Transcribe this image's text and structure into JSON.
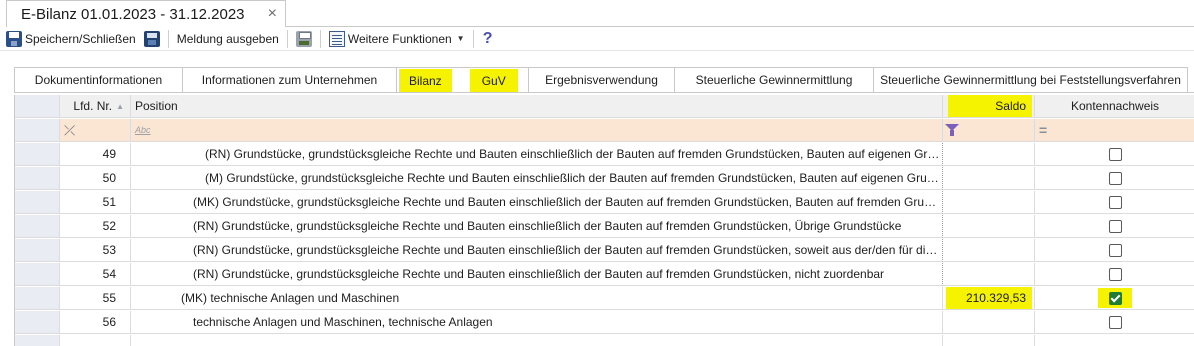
{
  "document_tab": {
    "title": "E-Bilanz 01.01.2023 - 31.12.2023",
    "close": "×"
  },
  "toolbar": {
    "save_close": "Speichern/Schließen",
    "report": "Meldung ausgeben",
    "more_functions": "Weitere Funktionen",
    "icons": [
      "save-close-icon",
      "disk-icon",
      "printer-icon",
      "functions-list-icon",
      "help-icon"
    ]
  },
  "tabs": [
    {
      "label": "Dokumentinformationen"
    },
    {
      "label": "Informationen zum Unternehmen"
    },
    {
      "label": "Bilanz",
      "active": true
    },
    {
      "label": "GuV"
    },
    {
      "label": "Ergebnisverwendung"
    },
    {
      "label": "Steuerliche Gewinnermittlung"
    },
    {
      "label": "Steuerliche Gewinnermittlung bei Feststellungsverfahren"
    }
  ],
  "grid": {
    "headers": {
      "nr": "Lfd. Nr.",
      "position": "Position",
      "saldo": "Saldo",
      "kontennachweis": "Kontennachweis"
    },
    "filter": {
      "position_placeholder": "Abc"
    },
    "rows": [
      {
        "nr": "49",
        "position": "(RN) Grundstücke, grundstücksgleiche Rechte und Bauten einschließlich der Bauten auf fremden Grundstücken, Bauten auf eigenen Grun…",
        "saldo": "",
        "checked": false
      },
      {
        "nr": "50",
        "position": "(M) Grundstücke, grundstücksgleiche Rechte und Bauten einschließlich der Bauten auf fremden Grundstücken, Bauten auf eigenen Grun…",
        "saldo": "",
        "checked": false
      },
      {
        "nr": "51",
        "position": "(MK) Grundstücke, grundstücksgleiche Rechte und Bauten einschließlich der Bauten auf fremden Grundstücken, Bauten auf fremden Grund…",
        "saldo": "",
        "checked": false
      },
      {
        "nr": "52",
        "position": "(RN) Grundstücke, grundstücksgleiche Rechte und Bauten einschließlich der Bauten auf fremden Grundstücken, Übrige Grundstücke",
        "saldo": "",
        "checked": false
      },
      {
        "nr": "53",
        "position": "(RN) Grundstücke, grundstücksgleiche Rechte und Bauten einschließlich der Bauten auf fremden Grundstücken, soweit aus der/den für die …",
        "saldo": "",
        "checked": false
      },
      {
        "nr": "54",
        "position": "(RN) Grundstücke, grundstücksgleiche Rechte und Bauten einschließlich der Bauten auf fremden Grundstücken, nicht zuordenbar",
        "saldo": "",
        "checked": false
      },
      {
        "nr": "55",
        "position": "(MK) technische Anlagen und Maschinen",
        "saldo": "210.329,53",
        "checked": true
      },
      {
        "nr": "56",
        "position": "technische Anlagen und Maschinen, technische Anlagen",
        "saldo": "",
        "checked": false
      }
    ]
  },
  "colors": {
    "highlight": "#f6f300",
    "check_green": "#1e7d32",
    "filter_row": "#fbe6d4"
  }
}
